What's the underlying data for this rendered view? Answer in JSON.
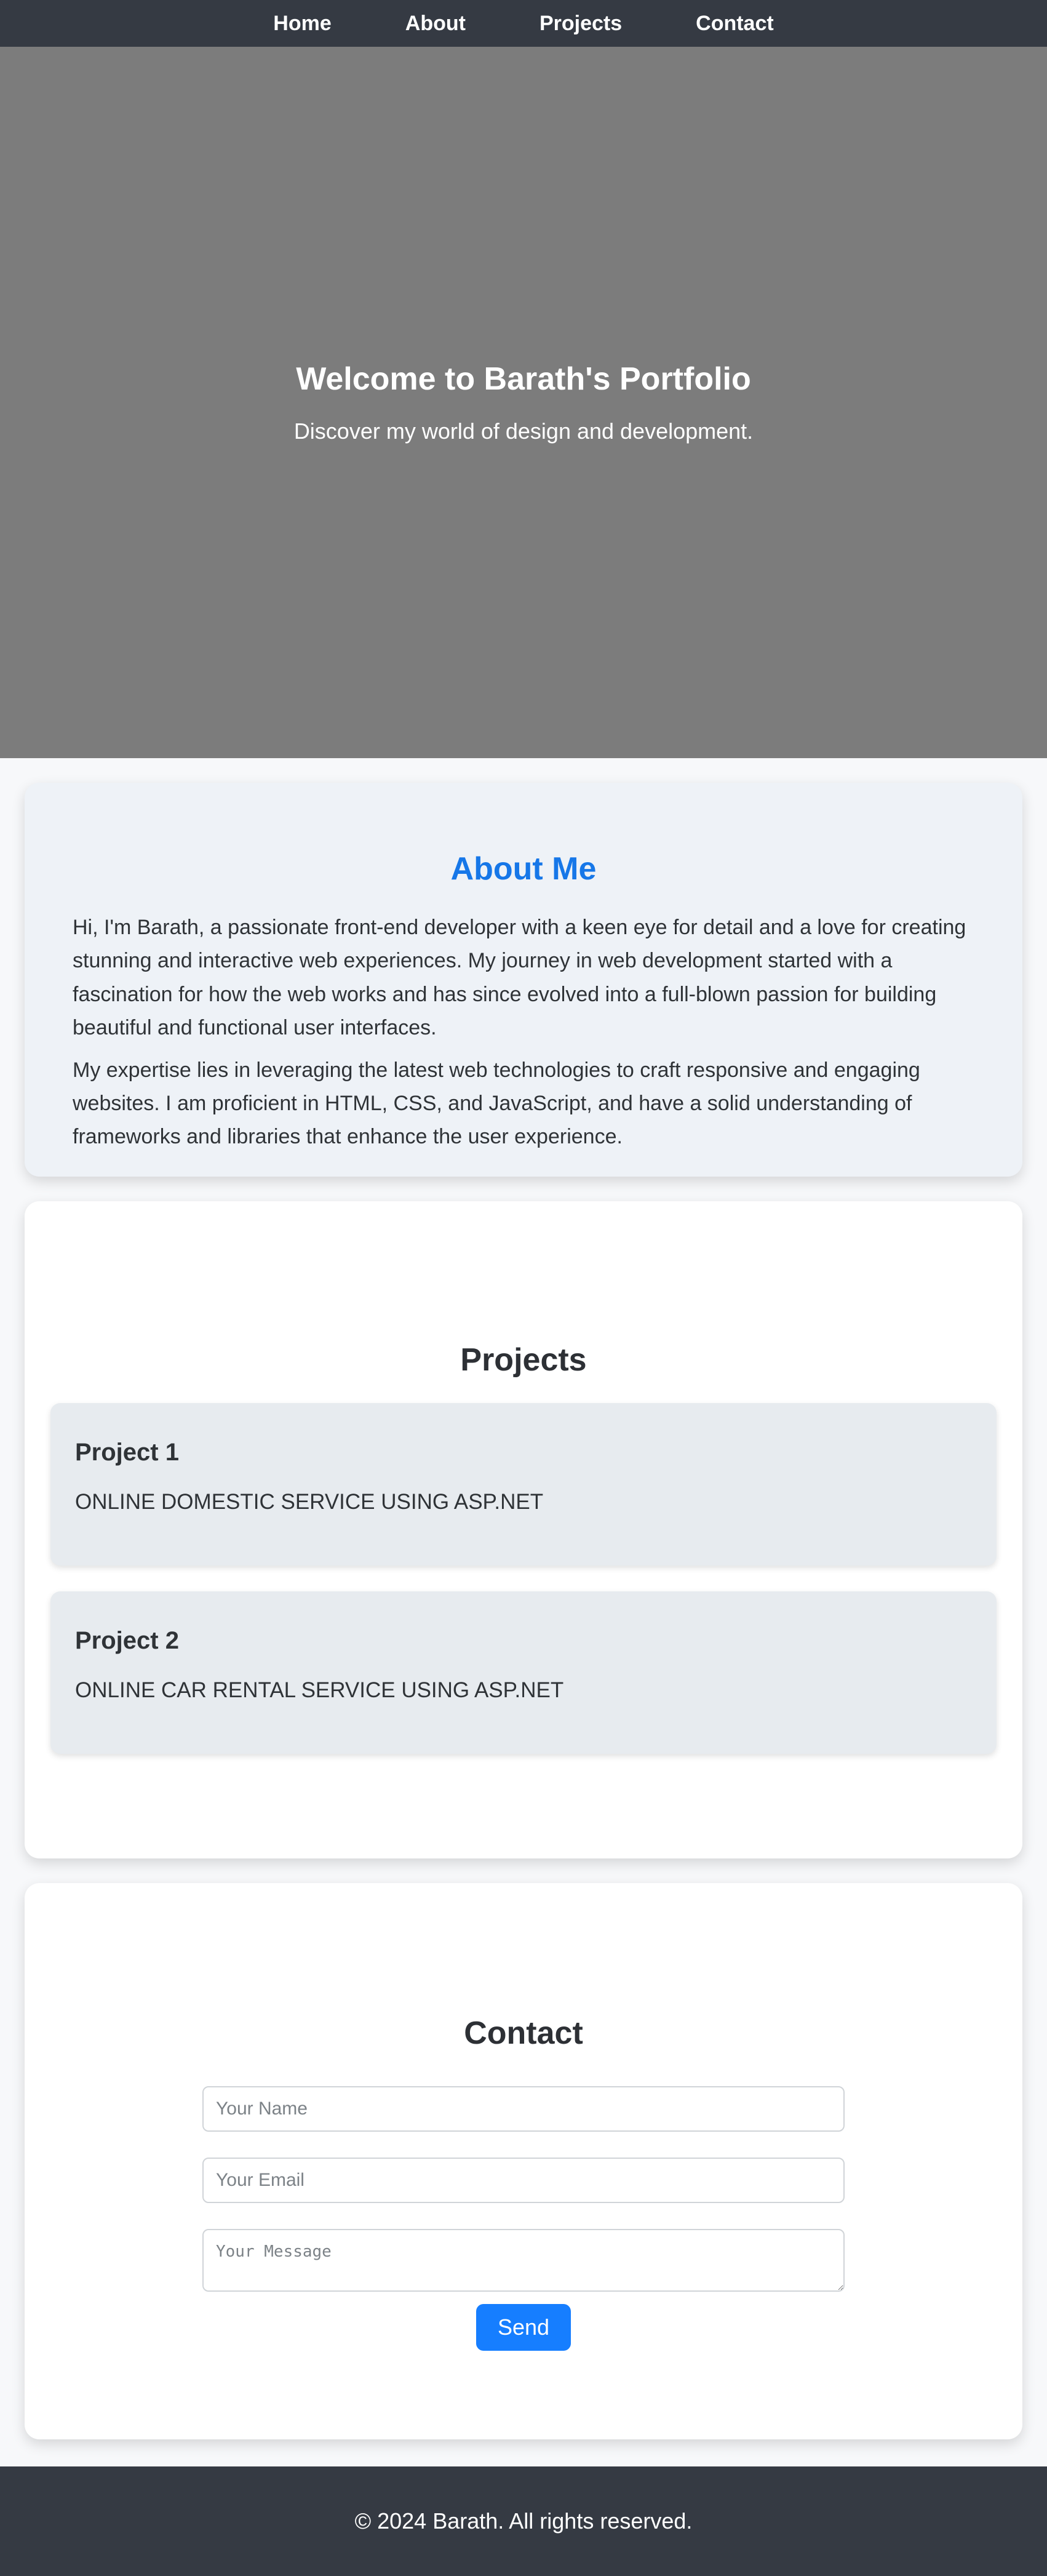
{
  "nav": {
    "items": [
      {
        "label": "Home"
      },
      {
        "label": "About"
      },
      {
        "label": "Projects"
      },
      {
        "label": "Contact"
      }
    ]
  },
  "hero": {
    "title": "Welcome to Barath's Portfolio",
    "subtitle": "Discover my world of design and development."
  },
  "about": {
    "title": "About Me",
    "paragraphs": [
      "Hi, I'm Barath, a passionate front-end developer with a keen eye for detail and a love for creating stunning and interactive web experiences. My journey in web development started with a fascination for how the web works and has since evolved into a full-blown passion for building beautiful and functional user interfaces.",
      "My expertise lies in leveraging the latest web technologies to craft responsive and engaging websites. I am proficient in HTML, CSS, and JavaScript, and have a solid understanding of frameworks and libraries that enhance the user experience."
    ]
  },
  "projects": {
    "title": "Projects",
    "items": [
      {
        "title": "Project 1",
        "description": "ONLINE DOMESTIC SERVICE USING ASP.NET"
      },
      {
        "title": "Project 2",
        "description": "ONLINE CAR RENTAL SERVICE USING ASP.NET"
      }
    ]
  },
  "contact": {
    "title": "Contact",
    "name_placeholder": "Your Name",
    "email_placeholder": "Your Email",
    "message_placeholder": "Your Message",
    "send_label": "Send"
  },
  "footer": {
    "text": "© 2024 Barath. All rights reserved."
  },
  "colors": {
    "nav_bg": "#353a43",
    "hero_bg": "#7c7c7c",
    "accent": "#1677e8",
    "button": "#167eff",
    "about_bg": "#eef2f7",
    "project_bg": "#e7ebef"
  }
}
